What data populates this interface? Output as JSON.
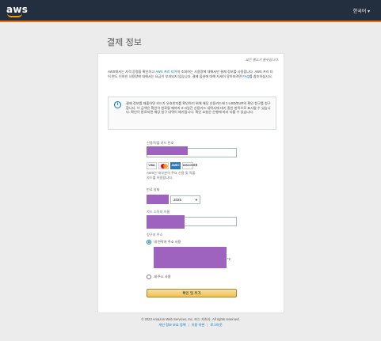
{
  "header": {
    "logo": "aws",
    "language": "한국어 ▾"
  },
  "page": {
    "title": "결제 정보"
  },
  "form": {
    "required_note": "모든 필드가 필수입니다.",
    "intro_before_link": "AWS에서는 자격 증명을 확인하고 ",
    "intro_link": "AWS 프리 티어",
    "intro_after_link": "의 조회하는 사용량에 대해서만 결제 정보를 사용합니다. AWS 프리 티어 한도 이하인 사용량에 대해서는 요금이 부과되지 않습니다. 결제 옵션에 대해 자세히 알아보려면 ",
    "faq_link": "FAQ",
    "intro_end": "를 참조하십시오.",
    "info_icon": "info-icon",
    "info_text": "결제 정보를 제출하면 카드가 유효한지를 확인하기 위해 해당 신용카드에 1 USD/EUR의 확인 청구를 청구합니다. 이 금액은 확인이 완료될 때까지 3~4일간 신용카드 내역서에 대기 중인 항목으로 표시될 수 있습니다. 확인이 완료되면 해당 청구 내역이 제거됩니다. 확인 요청은 은행에 따라 다를 수 있습니다.",
    "card_number_label": "신용/직불 카드 번호",
    "card_brands": [
      "VISA",
      "MasterCard",
      "AMEX",
      "DISCOVER"
    ],
    "card_note": "AWS는 대부분의 주요 신용 및 직불 카드를 허용합니다.",
    "expiry_label": "만료 날짜",
    "expiry_year": "2025",
    "cardholder_label": "카드 소유자 이름",
    "billing_label": "청구지 주소",
    "use_my_address": "내 연락처 주소 사용",
    "address_note": "*2",
    "new_address": "새 주소 사용",
    "submit": "확인 및 추가"
  },
  "footer": {
    "copyright": "© 2023 Amazon Web Services, Inc. 또는 자회사. All rights reserved.",
    "links": [
      "개인 정보 보호 정책",
      "이용 약관",
      "로그아웃"
    ]
  },
  "colors": {
    "header": "#232f3e",
    "accent": "#ec7211",
    "link": "#0073bb",
    "button": "#f0c14b",
    "redaction": "#9d63bf"
  }
}
